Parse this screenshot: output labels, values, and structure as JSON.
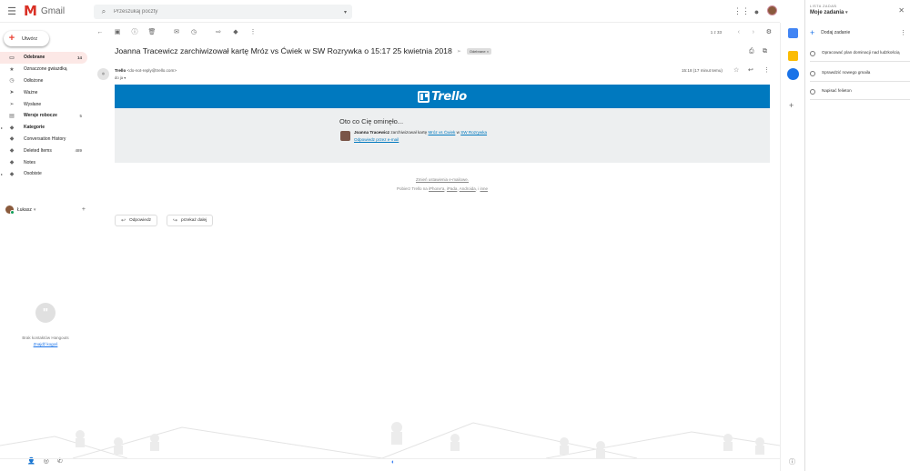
{
  "header": {
    "app_name": "Gmail",
    "search_placeholder": "Przeszukaj poczty"
  },
  "sidebar": {
    "compose_label": "Utwórz",
    "items": [
      {
        "label": "Odebrane",
        "count": "14",
        "icon": "inbox-icon",
        "active": true
      },
      {
        "label": "Oznaczone gwiazdką",
        "count": "",
        "icon": "star-icon"
      },
      {
        "label": "Odłożone",
        "count": "",
        "icon": "clock-icon"
      },
      {
        "label": "Ważne",
        "count": "",
        "icon": "important-icon"
      },
      {
        "label": "Wysłane",
        "count": "",
        "icon": "send-icon"
      },
      {
        "label": "Wersje robocze",
        "count": "5",
        "icon": "draft-icon",
        "bold": true
      },
      {
        "label": "Kategorie",
        "count": "",
        "icon": "label-icon",
        "bold": true,
        "expand": true
      },
      {
        "label": "Conversation History",
        "count": "",
        "icon": "label-icon"
      },
      {
        "label": "Deleted Items",
        "count": "489",
        "icon": "label-icon"
      },
      {
        "label": "Notes",
        "count": "",
        "icon": "label-icon"
      },
      {
        "label": "Osobiste",
        "count": "",
        "icon": "label-icon",
        "expand": true
      }
    ],
    "user_name": "Łukasz",
    "hangouts_empty": "Brak kontaktów Hangouts",
    "hangouts_find": "Znajdź kogoś"
  },
  "toolbar": {
    "pagination": "1 z 33"
  },
  "message": {
    "subject": "Joanna Tracewicz zarchiwizował kartę Mróz vs Ćwiek w SW Rozrywka o 15:17 25 kwietnia 2018",
    "label": "Odebrane ×",
    "sender_name": "Trello",
    "sender_email": "<do-not-reply@trello.com>",
    "to": "do ja ▾",
    "time": "15:18 (17 minut temu)"
  },
  "email": {
    "brand": "Trello",
    "missed": "Oto co Cię ominęło...",
    "actor": "Joanna Tracewicz",
    "action_text": " zarchiwizował kartę ",
    "card_name": "Mróz vs Ćwiek",
    "in_text": " w ",
    "board_name": "SW Rozrywka",
    "reply_link": "Odpowiedz przez e-mail",
    "settings_link": "Zmień ustawienia e-mailowe.",
    "download_text": "Pobierz Trello na ",
    "iphone": "iPhone'a",
    "ipad": "iPada",
    "android": "Androida",
    "more": "inne"
  },
  "actions": {
    "reply": "Odpowiedz",
    "forward": "przekaż dalej"
  },
  "tasks": {
    "header_small": "LISTA ZADAŃ",
    "list_name": "Moje zadania",
    "add_label": "Dodaj zadanie",
    "items": [
      "Opracować plan dominacji nad ludzkością",
      "Sprawdzić nowego gmaila",
      "Napisać felieton"
    ]
  },
  "colors": {
    "trello_blue": "#0079bf",
    "active_nav_bg": "#fce8e6",
    "gmail_red": "#d93025"
  }
}
